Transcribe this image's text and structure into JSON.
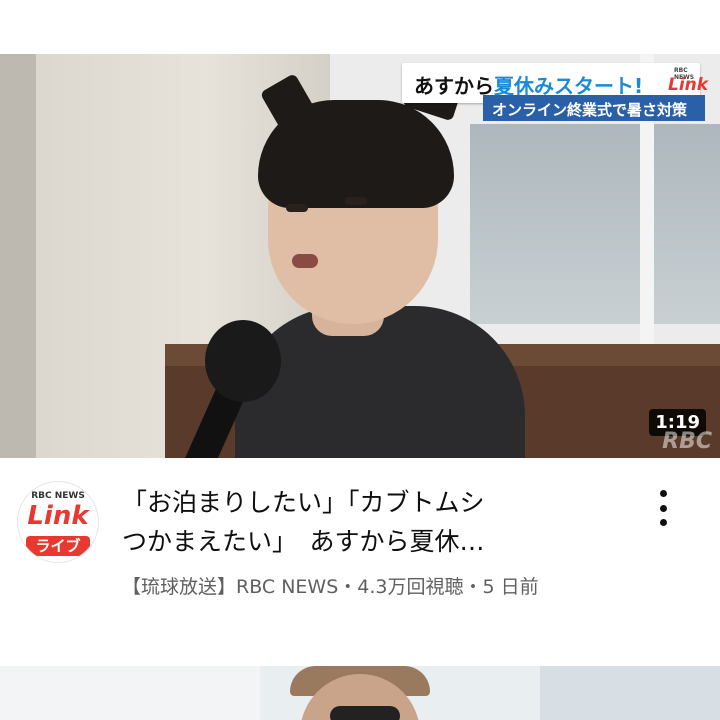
{
  "video": {
    "banner": {
      "headline_prefix": "あすから",
      "headline_accent": "夏休みスタート!",
      "brand_small": "RBC NEWS",
      "brand_link": "Link",
      "subheadline": "オンライン終業式で暑さ対策"
    },
    "duration": "1:19",
    "watermark": "RBC",
    "title_line1": "「お泊まりしたい」「カブトムシ",
    "title_line2": "つかまえたい」　あすから夏休…",
    "meta": "【琉球放送】RBC NEWS・4.3万回視聴・5 日前"
  },
  "channel_avatar": {
    "small_text": "RBC NEWS",
    "link_text": "Link",
    "live_text": "ライブ"
  },
  "colors": {
    "accent_blue": "#1a8ad4",
    "brand_red": "#e8382f",
    "subbanner_blue": "#2a60a8",
    "meta_gray": "#606060"
  }
}
